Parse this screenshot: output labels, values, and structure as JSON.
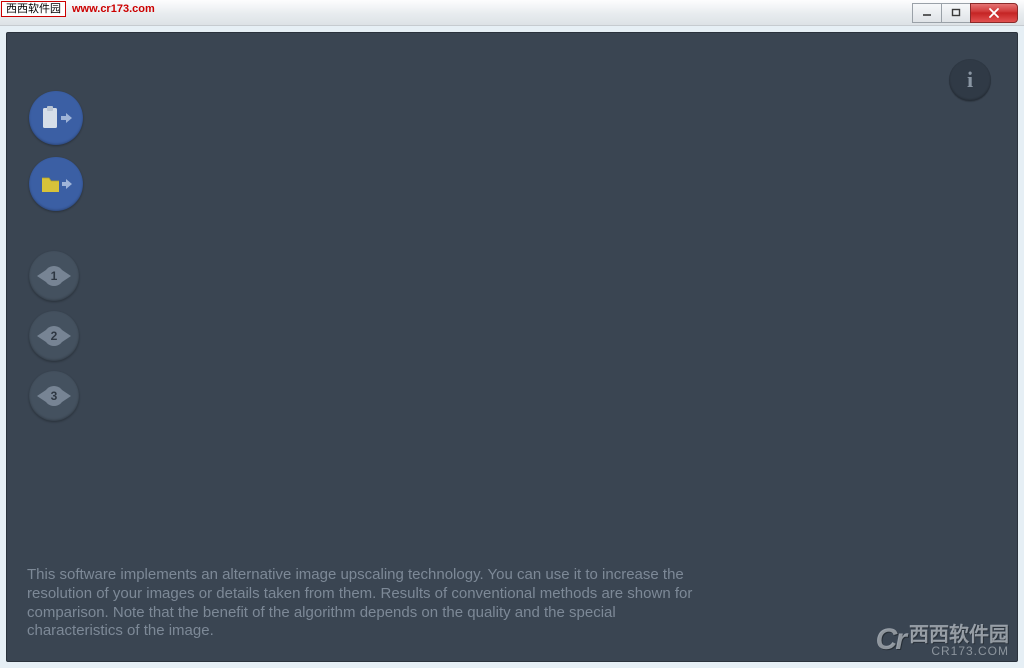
{
  "overlay": {
    "badge_text": "西西软件园",
    "badge_url": "www.cr173.com"
  },
  "window_controls": {
    "minimize": "minimize",
    "maximize": "maximize",
    "close": "close"
  },
  "sidebar": {
    "paste_btn": {
      "icon": "clipboard-arrow",
      "label": "Paste from clipboard"
    },
    "open_btn": {
      "icon": "folder-arrow",
      "label": "Open from folder"
    },
    "views": [
      {
        "icon": "eye",
        "num": "1"
      },
      {
        "icon": "eye",
        "num": "2"
      },
      {
        "icon": "eye",
        "num": "3"
      }
    ]
  },
  "info_button": {
    "label": "i"
  },
  "description": "This software implements an alternative image upscaling technology. You can use it to increase the resolution of your images or details taken from them. Results of conventional methods are shown for comparison. Note that the benefit of the algorithm depends on the quality and the special characteristics of the image.",
  "watermark": {
    "logo": "Cr",
    "line1": "西西软件园",
    "line2": "CR173.COM"
  },
  "colors": {
    "panel_bg": "#3a4552",
    "accent_blue": "#3b5fa4",
    "folder_yellow": "#d7c23a",
    "muted_text": "#7d8997"
  }
}
